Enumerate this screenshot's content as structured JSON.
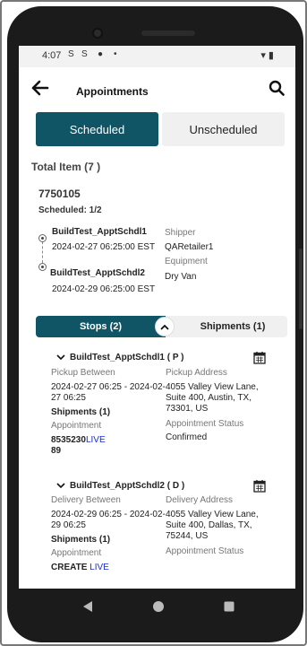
{
  "status_bar": {
    "time": "4:07",
    "icons_left": [
      "S",
      "S",
      "●",
      "•"
    ],
    "icons_right": "▾ ▮"
  },
  "header": {
    "title": "Appointments"
  },
  "segments": {
    "active": "Scheduled",
    "inactive": "Unscheduled"
  },
  "total_label": "Total Item (7 )",
  "load": {
    "id": "7750105",
    "scheduled": "Scheduled: 1/2",
    "stops": [
      {
        "name": "BuildTest_ApptSchdl1",
        "time": "2024-02-27 06:25:00 EST"
      },
      {
        "name": "BuildTest_ApptSchdl2",
        "time": "2024-02-29 06:25:00 EST"
      }
    ],
    "shipper_label": "Shipper",
    "shipper_value": "QARetailer1",
    "equipment_label": "Equipment",
    "equipment_value": "Dry Van"
  },
  "tabs": {
    "stops": "Stops (2)",
    "shipments": "Shipments (1)"
  },
  "stop_details": [
    {
      "title": "BuildTest_ApptSchdl1  ( P )",
      "window_label": "Pickup Between",
      "window_value": "2024-02-27 06:25 - 2024-02-27 06:25",
      "shipments": "Shipments (1)",
      "appointment_label": "Appointment",
      "appointment_value": "8535230",
      "appointment_value2": "89",
      "live": "LIVE",
      "address_label": "Pickup Address",
      "address_value": "4055 Valley View Lane, Suite 400, Austin, TX, 73301, US",
      "status_label": "Appointment Status",
      "status_value": "Confirmed"
    },
    {
      "title": "BuildTest_ApptSchdl2  ( D )",
      "window_label": "Delivery Between",
      "window_value": "2024-02-29 06:25 - 2024-02-29 06:25",
      "shipments": "Shipments (1)",
      "appointment_label": "Appointment",
      "appointment_value": "CREATE",
      "live": "LIVE",
      "address_label": "Delivery Address",
      "address_value": "4055 Valley View Lane, Suite 400, Dallas, TX, 75244, US",
      "status_label": "Appointment Status"
    }
  ],
  "colors": {
    "accent": "#0f5566",
    "live": "#1a2fc7"
  },
  "icons": [
    "back-arrow-icon",
    "search-icon",
    "chevron-down-icon",
    "chevron-up-icon",
    "calendar-icon",
    "nav-back-icon",
    "nav-home-icon",
    "nav-recents-icon"
  ]
}
